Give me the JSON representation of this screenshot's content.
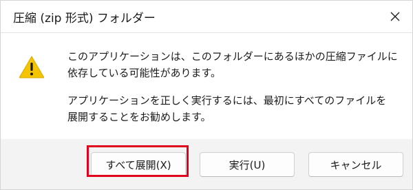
{
  "window": {
    "title": "圧縮 (zip 形式) フォルダー",
    "close_icon": "close-icon"
  },
  "dialog": {
    "icon": "warning-icon",
    "message1_line1": "このアプリケーションは、このフォルダーにあるほかの圧縮ファイルに",
    "message1_line2": "依存している可能性があります。",
    "message2_line1": "アプリケーションを正しく実行するには、最初にすべてのファイルを",
    "message2_line2": "展開することをお勧めします。"
  },
  "buttons": {
    "extract_all": "すべて展開(X)",
    "run": "実行(U)",
    "cancel": "キャンセル"
  },
  "colors": {
    "highlight": "#e0001b",
    "warning_fill": "#f5c400"
  }
}
